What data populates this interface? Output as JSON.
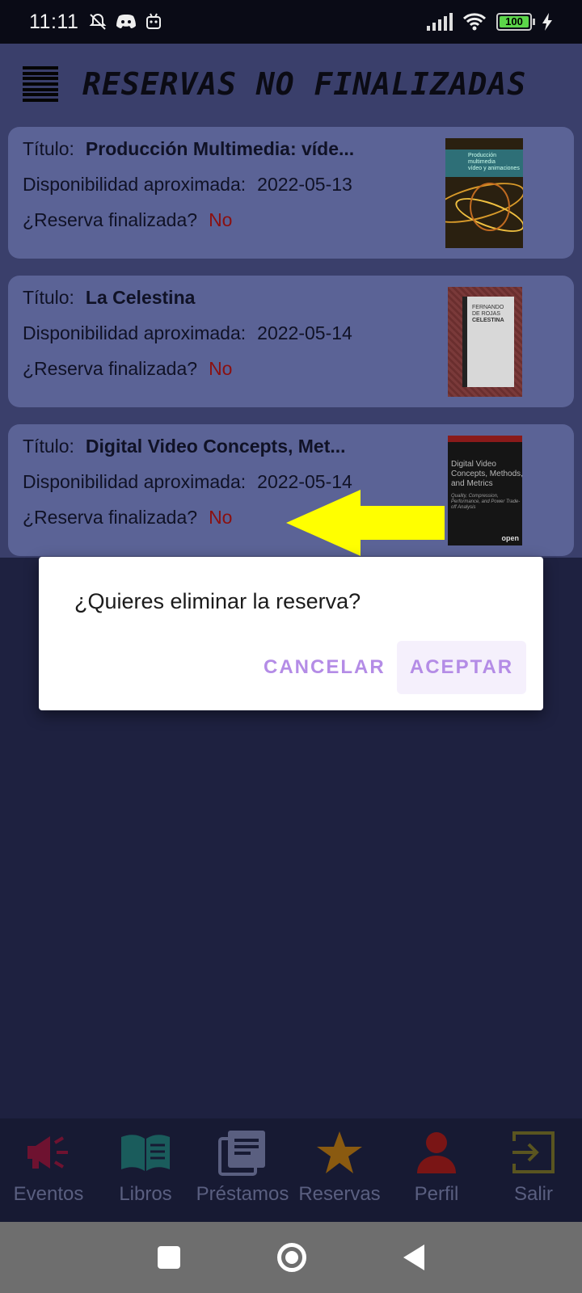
{
  "status_bar": {
    "time": "11:11",
    "left_icons": [
      "notifications-off-icon",
      "discord-icon",
      "android-robot-icon"
    ],
    "battery_level": "100",
    "right_icons": [
      "signal-icon",
      "wifi-icon",
      "battery-icon",
      "charging-icon"
    ]
  },
  "header": {
    "title": "RESERVAS NO FINALIZADAS",
    "menu_icon": "hamburger-menu-icon"
  },
  "labels": {
    "title": "Título:",
    "availability": "Disponibilidad aproximada:",
    "finished": "¿Reserva finalizada?"
  },
  "reservations": [
    {
      "title": "Producción Multimedia: víde...",
      "date": "2022-05-13",
      "finished": "No"
    },
    {
      "title": "La Celestina",
      "date": "2022-05-14",
      "finished": "No"
    },
    {
      "title": "Digital Video Concepts, Met...",
      "date": "2022-05-14",
      "finished": "No"
    }
  ],
  "covers": {
    "prod": {
      "line1": "Producción multimedia",
      "line2": "vídeo y animaciones"
    },
    "cel": {
      "line1": "FERNANDO",
      "line2": "DE ROJAS",
      "line3": "CELESTINA"
    },
    "dvc": {
      "title": "Digital Video Concepts, Methods, and Metrics",
      "subtitle": "Quality, Compression, Performance, and Power Trade-off Analysis",
      "publisher": "open"
    }
  },
  "dialog": {
    "message": "¿Quieres eliminar la reserva?",
    "cancel": "CANCELAR",
    "accept": "ACEPTAR"
  },
  "bottom_nav": [
    {
      "label": "Eventos",
      "icon": "megaphone-icon",
      "color": "#6e1230"
    },
    {
      "label": "Libros",
      "icon": "open-book-icon",
      "color": "#1a5c5c"
    },
    {
      "label": "Préstamos",
      "icon": "documents-icon",
      "color": "#5a5f80"
    },
    {
      "label": "Reservas",
      "icon": "star-icon",
      "color": "#8a5a10"
    },
    {
      "label": "Perfil",
      "icon": "person-icon",
      "color": "#7a1515"
    },
    {
      "label": "Salir",
      "icon": "exit-icon",
      "color": "#5a5520"
    }
  ],
  "colors": {
    "annotation_arrow": "#ffff00",
    "dialog_button": "#b48ce6",
    "no_text": "#8b1010"
  }
}
